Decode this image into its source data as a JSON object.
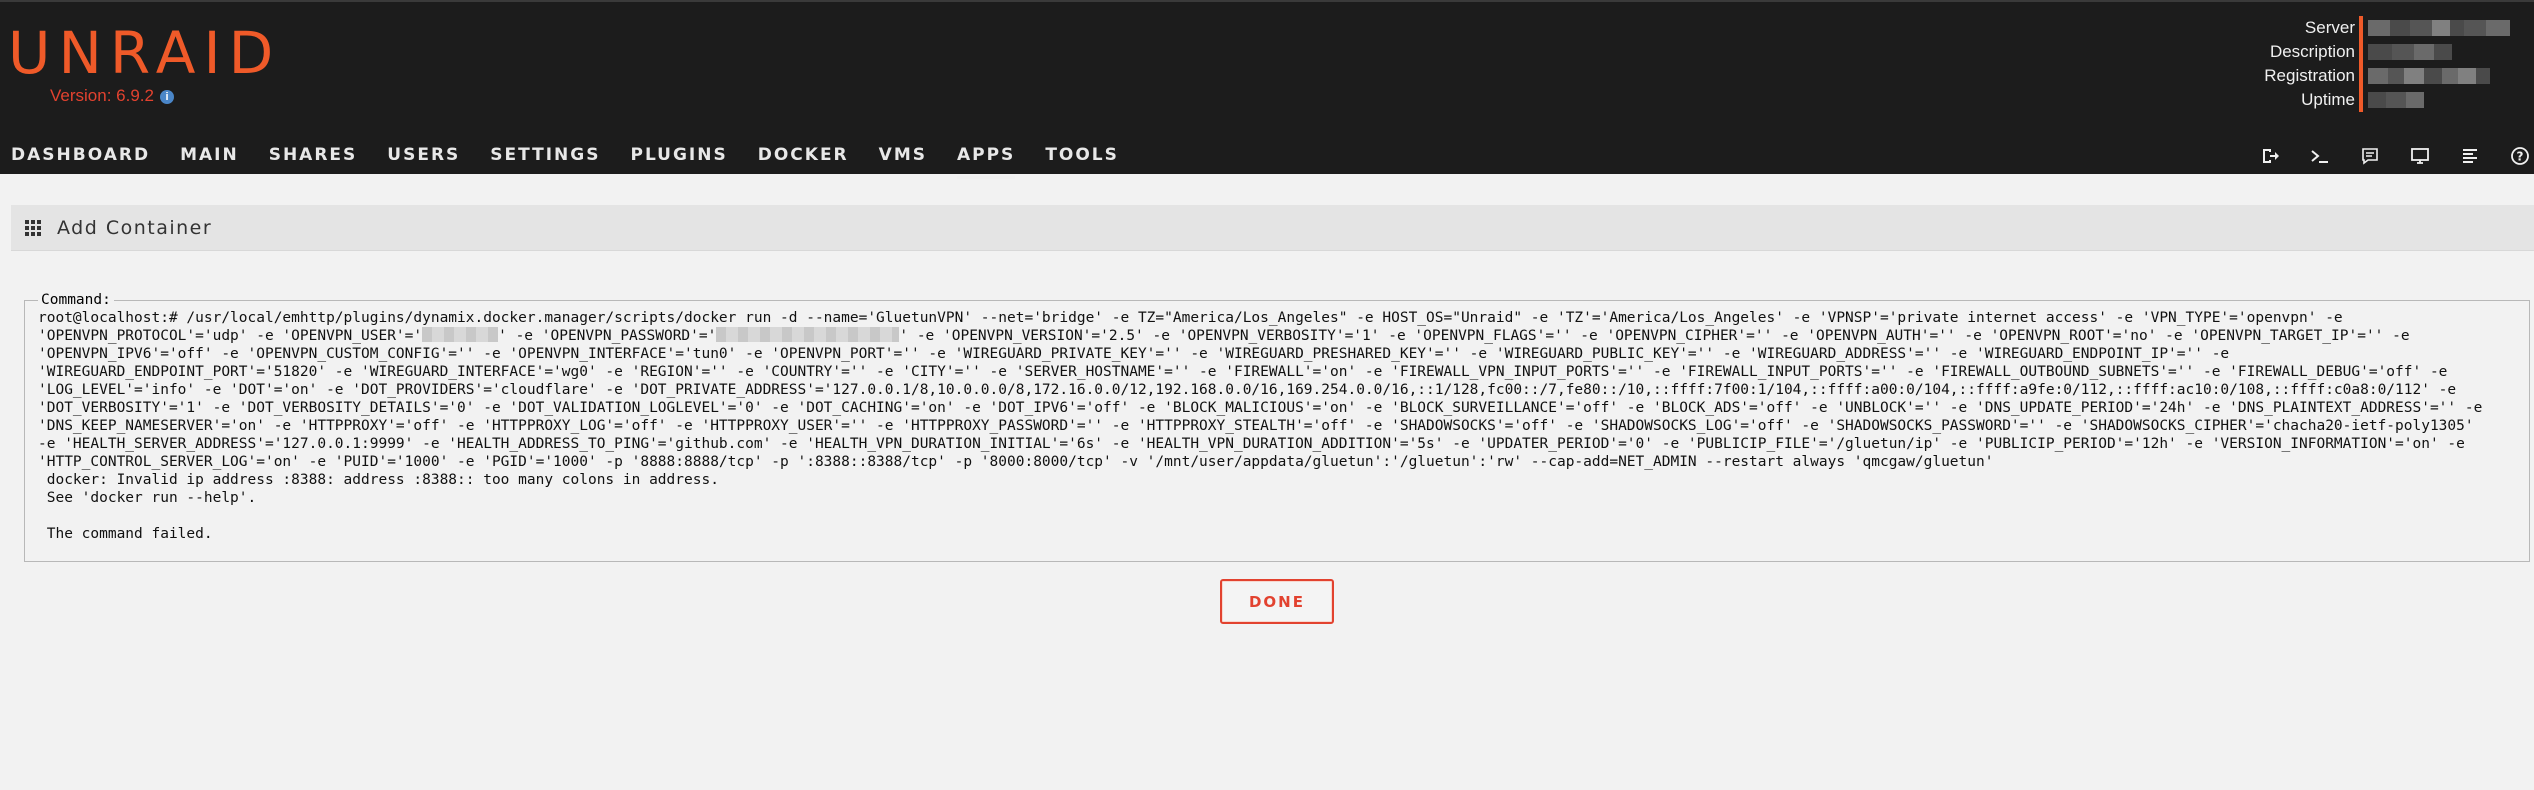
{
  "brand": {
    "logo": "UNRAID",
    "version": "Version: 6.9.2"
  },
  "server_info": {
    "labels": [
      "Server",
      "Description",
      "Registration",
      "Uptime"
    ]
  },
  "nav": {
    "items": [
      "DASHBOARD",
      "MAIN",
      "SHARES",
      "USERS",
      "SETTINGS",
      "PLUGINS",
      "DOCKER",
      "VMS",
      "APPS",
      "TOOLS"
    ],
    "active": "APPS"
  },
  "toolbar": {
    "icons": [
      "logout-icon",
      "terminal-icon",
      "feedback-icon",
      "monitor-icon",
      "log-icon",
      "help-icon"
    ]
  },
  "page": {
    "title": "Add Container"
  },
  "command": {
    "legend": "Command:",
    "lines": [
      "root@localhost:# /usr/local/emhttp/plugins/dynamix.docker.manager/scripts/docker run -d --name='GluetunVPN' --net='bridge' -e TZ=\"America/Los_Angeles\" -e HOST_OS=\"Unraid\" -e 'TZ'='America/Los_Angeles' -e 'VPNSP'='private internet access' -e 'VPN_TYPE'='openvpn' -e",
      "'OPENVPN_PROTOCOL'='udp' -e 'OPENVPN_USER'='",
      "' -e 'OPENVPN_PASSWORD'='",
      "' -e 'OPENVPN_VERSION'='2.5' -e 'OPENVPN_VERBOSITY'='1' -e 'OPENVPN_FLAGS'='' -e 'OPENVPN_CIPHER'='' -e 'OPENVPN_AUTH'='' -e 'OPENVPN_ROOT'='no' -e 'OPENVPN_TARGET_IP'='' -e",
      "'OPENVPN_IPV6'='off' -e 'OPENVPN_CUSTOM_CONFIG'='' -e 'OPENVPN_INTERFACE'='tun0' -e 'OPENVPN_PORT'='' -e 'WIREGUARD_PRIVATE_KEY'='' -e 'WIREGUARD_PRESHARED_KEY'='' -e 'WIREGUARD_PUBLIC_KEY'='' -e 'WIREGUARD_ADDRESS'='' -e 'WIREGUARD_ENDPOINT_IP'='' -e",
      "'WIREGUARD_ENDPOINT_PORT'='51820' -e 'WIREGUARD_INTERFACE'='wg0' -e 'REGION'='' -e 'COUNTRY'='' -e 'CITY'='' -e 'SERVER_HOSTNAME'='' -e 'FIREWALL'='on' -e 'FIREWALL_VPN_INPUT_PORTS'='' -e 'FIREWALL_INPUT_PORTS'='' -e 'FIREWALL_OUTBOUND_SUBNETS'='' -e 'FIREWALL_DEBUG'='off' -e",
      "'LOG_LEVEL'='info' -e 'DOT'='on' -e 'DOT_PROVIDERS'='cloudflare' -e 'DOT_PRIVATE_ADDRESS'='127.0.0.1/8,10.0.0.0/8,172.16.0.0/12,192.168.0.0/16,169.254.0.0/16,::1/128,fc00::/7,fe80::/10,::ffff:7f00:1/104,::ffff:a00:0/104,::ffff:a9fe:0/112,::ffff:ac10:0/108,::ffff:c0a8:0/112' -e",
      "'DOT_VERBOSITY'='1' -e 'DOT_VERBOSITY_DETAILS'='0' -e 'DOT_VALIDATION_LOGLEVEL'='0' -e 'DOT_CACHING'='on' -e 'DOT_IPV6'='off' -e 'BLOCK_MALICIOUS'='on' -e 'BLOCK_SURVEILLANCE'='off' -e 'BLOCK_ADS'='off' -e 'UNBLOCK'='' -e 'DNS_UPDATE_PERIOD'='24h' -e 'DNS_PLAINTEXT_ADDRESS'='' -e",
      "'DNS_KEEP_NAMESERVER'='on' -e 'HTTPPROXY'='off' -e 'HTTPPROXY_LOG'='off' -e 'HTTPPROXY_USER'='' -e 'HTTPPROXY_PASSWORD'='' -e 'HTTPPROXY_STEALTH'='off' -e 'SHADOWSOCKS'='off' -e 'SHADOWSOCKS_LOG'='off' -e 'SHADOWSOCKS_PASSWORD'='' -e 'SHADOWSOCKS_CIPHER'='chacha20-ietf-poly1305'",
      "-e 'HEALTH_SERVER_ADDRESS'='127.0.0.1:9999' -e 'HEALTH_ADDRESS_TO_PING'='github.com' -e 'HEALTH_VPN_DURATION_INITIAL'='6s' -e 'HEALTH_VPN_DURATION_ADDITION'='5s' -e 'UPDATER_PERIOD'='0' -e 'PUBLICIP_FILE'='/gluetun/ip' -e 'PUBLICIP_PERIOD'='12h' -e 'VERSION_INFORMATION'='on' -e",
      "'HTTP_CONTROL_SERVER_LOG'='on' -e 'PUID'='1000' -e 'PGID'='1000' -p '8888:8888/tcp' -p ':8388::8388/tcp' -p '8000:8000/tcp' -v '/mnt/user/appdata/gluetun':'/gluetun':'rw' --cap-add=NET_ADMIN --restart always 'qmcgaw/gluetun'",
      " docker: Invalid ip address :8388: address :8388:: too many colons in address.",
      " See 'docker run --help'.",
      "",
      " The command failed."
    ]
  },
  "actions": {
    "done_label": "DONE"
  }
}
